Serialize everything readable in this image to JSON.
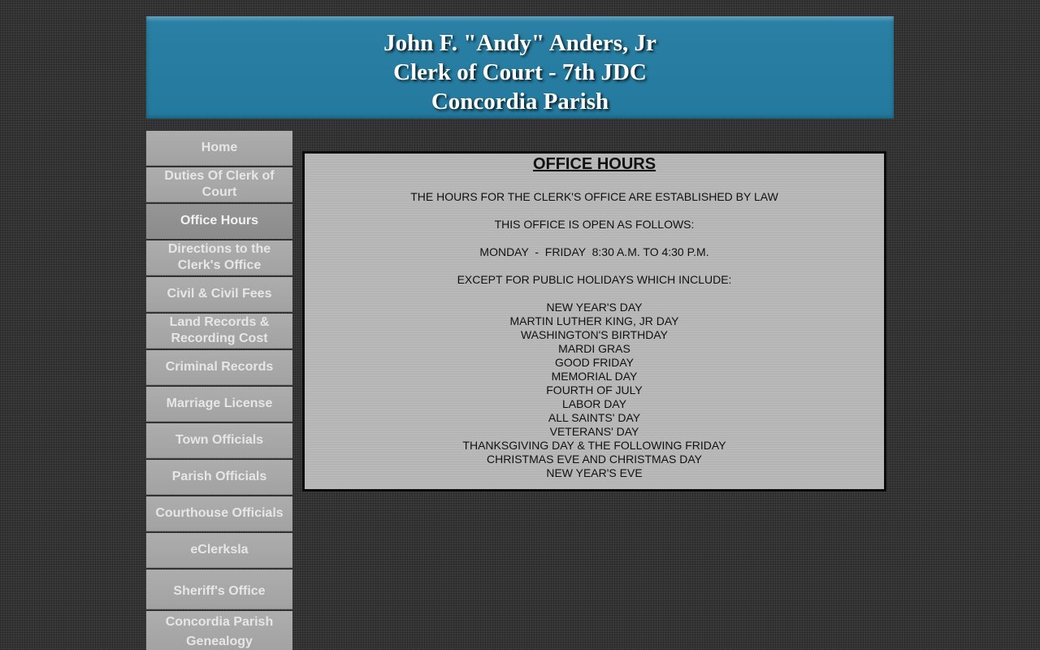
{
  "header": {
    "line1": "John F. \"Andy\" Anders, Jr",
    "line2": "Clerk of Court - 7th JDC",
    "line3": "Concordia Parish"
  },
  "nav": {
    "items": [
      {
        "label": "Home"
      },
      {
        "label": "Duties Of Clerk of Court"
      },
      {
        "label": "Office Hours"
      },
      {
        "label": "Directions to the Clerk's Office"
      },
      {
        "label": "Civil & Civil Fees"
      },
      {
        "label": "Land Records & Recording Cost"
      },
      {
        "label": "Criminal Records"
      },
      {
        "label": "Marriage License"
      },
      {
        "label": "Town Officials"
      },
      {
        "label": "Parish Officials"
      },
      {
        "label": "Courthouse Officials"
      },
      {
        "label": "eClerksla"
      },
      {
        "label": "Sheriff's Office"
      },
      {
        "label": "Concordia Parish Genealogy"
      }
    ]
  },
  "content": {
    "title": "OFFICE HOURS",
    "intro": "THE HOURS FOR THE CLERK'S OFFICE ARE ESTABLISHED BY LAW",
    "open_as": "THIS OFFICE IS OPEN AS FOLLOWS:",
    "schedule": "MONDAY  -  FRIDAY  8:30 A.M. TO 4:30 P.M.",
    "except": "EXCEPT FOR PUBLIC HOLIDAYS WHICH INCLUDE:",
    "holidays": [
      "NEW YEAR'S DAY",
      "MARTIN LUTHER KING, JR DAY",
      "WASHINGTON'S BIRTHDAY",
      "MARDI GRAS",
      "GOOD FRIDAY",
      "MEMORIAL DAY",
      "FOURTH OF JULY",
      "LABOR DAY",
      "ALL SAINTS' DAY",
      "VETERANS' DAY",
      "THANKSGIVING DAY & THE FOLLOWING FRIDAY",
      "CHRISTMAS EVE AND CHRISTMAS DAY",
      "NEW YEAR'S EVE"
    ]
  }
}
